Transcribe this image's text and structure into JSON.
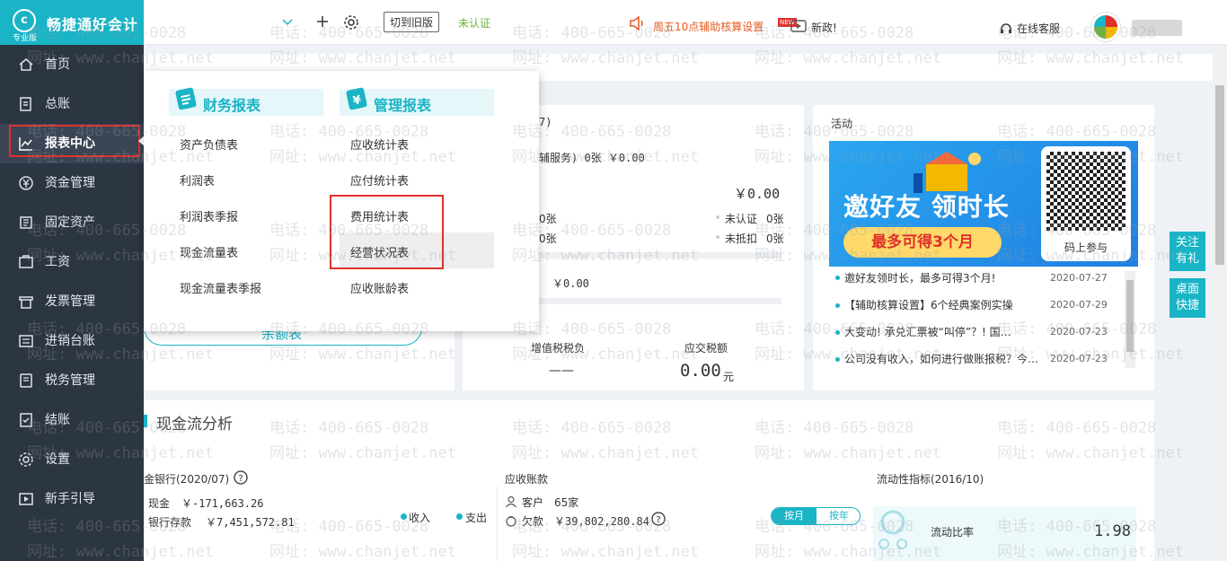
{
  "app": {
    "title": "畅捷通好会计",
    "edition": "专业版",
    "logo_letter": "c"
  },
  "sidebar": {
    "items": [
      {
        "label": "首页",
        "icon": "home-icon"
      },
      {
        "label": "总账",
        "icon": "ledger-icon"
      },
      {
        "label": "报表中心",
        "icon": "chart-line-icon",
        "active": true
      },
      {
        "label": "资金管理",
        "icon": "money-icon"
      },
      {
        "label": "固定资产",
        "icon": "asset-icon"
      },
      {
        "label": "工资",
        "icon": "salary-icon"
      },
      {
        "label": "发票管理",
        "icon": "invoice-icon"
      },
      {
        "label": "进销台账",
        "icon": "inventory-icon"
      },
      {
        "label": "税务管理",
        "icon": "tax-icon"
      },
      {
        "label": "结账",
        "icon": "close-books-icon"
      },
      {
        "label": "设置",
        "icon": "gear-icon"
      },
      {
        "label": "新手引导",
        "icon": "guide-icon"
      }
    ]
  },
  "topbar": {
    "switch_old": "切到旧版",
    "unverified": "未认证",
    "notice": "周五10点辅助核算设置",
    "new_badge": "NEW",
    "new_policy": "新政!",
    "online_service": "在线客服"
  },
  "menu": {
    "finance_title": "财务报表",
    "mgmt_title": "管理报表",
    "finance_items": [
      "资产负债表",
      "利润表",
      "利润表季报",
      "现金流量表",
      "现金流量表季报"
    ],
    "mgmt_items": [
      "应收统计表",
      "应付统计表",
      "费用统计表",
      "经营状况表",
      "应收账龄表"
    ]
  },
  "invoice": {
    "header_frag": "7)",
    "service_frag": "辅服务) 0张 ￥0.00",
    "amount1": "￥0.00",
    "count_a": "0张",
    "count_b": "0张",
    "unverified_label": "未认证",
    "unverified_count": "0张",
    "undeducted_label": "未抵扣",
    "undeducted_count": "0张",
    "amount2": "￥0.00",
    "vat_label": "增值税税负",
    "vat_value": "——",
    "tax_due_label": "应交税额",
    "tax_due_value": "0.00",
    "tax_due_unit": "元"
  },
  "left_card": {
    "button_frag": "余额表"
  },
  "activity": {
    "title": "活动",
    "banner_title": "邀好友 领时长",
    "banner_sub": "最多可得3个月",
    "qr_caption": "码上参与",
    "news": [
      {
        "text": "邀好友领时长，最多可得3个月!",
        "date": "2020-07-27"
      },
      {
        "text": "【辅助核算设置】6个经典案例实操",
        "date": "2020-07-29"
      },
      {
        "text": "大变动! 承兑汇票被“叫停”？! 国…",
        "date": "2020-07-23"
      },
      {
        "text": "公司没有收入，如何进行做账报税？今…",
        "date": "2020-07-23"
      }
    ]
  },
  "side_buttons": {
    "follow": "关注有礼",
    "desktop": "桌面快捷"
  },
  "cashflow": {
    "title": "现金流分析",
    "bank_title": "金银行(2020/07)",
    "cash_label": "现金",
    "cash_value": "￥-171,663.26",
    "bank_label": "银行存款",
    "bank_value": "￥7,451,572.81",
    "income": "收入",
    "expense": "支出",
    "ar_title": "应收账款",
    "customer_label": "客户",
    "customer_value": "65家",
    "owed_label": "欠款",
    "owed_value": "￥39,802,280.84",
    "by_month": "按月",
    "by_year": "按年",
    "liquidity_title": "流动性指标(2016/10)",
    "ratio_label": "流动比率",
    "ratio_value": "1.98"
  },
  "watermark": {
    "phone": "电话: 400-665-0028",
    "site": "网址: www.chanjet.net"
  },
  "colors": {
    "brand": "#19b4c6",
    "sidebar": "#2c3542",
    "highlight": "#e0302b",
    "notice": "#e85a1c",
    "unverified": "#6bb33a"
  }
}
